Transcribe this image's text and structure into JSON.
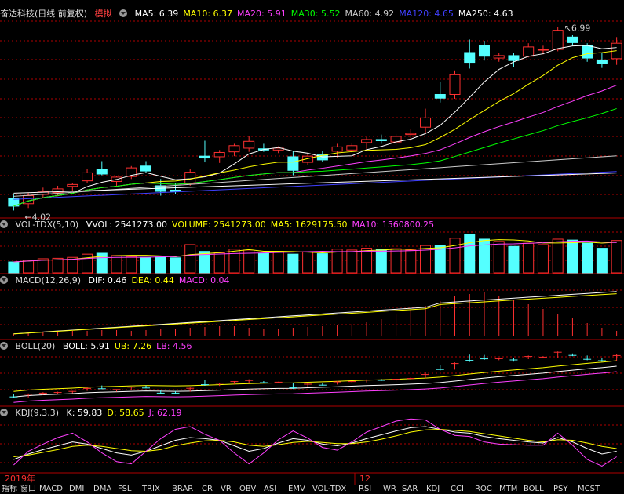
{
  "main_header": {
    "stock_name": "奋达科技(日线 前复权)",
    "mode": "模拟",
    "ma": [
      {
        "label": "MA5: 6.39",
        "color": "#ffffff"
      },
      {
        "label": "MA10: 6.37",
        "color": "#ffff00"
      },
      {
        "label": "MA20: 5.91",
        "color": "#ff40ff"
      },
      {
        "label": "MA30: 5.52",
        "color": "#00ff00"
      },
      {
        "label": "MA60: 4.92",
        "color": "#cccccc"
      },
      {
        "label": "MA120: 4.65",
        "color": "#4040ff"
      },
      {
        "label": "MA250: 4.63",
        "color": "#ffffff"
      }
    ]
  },
  "vol_header": {
    "name": "VOL-TDX(5,10)",
    "items": [
      {
        "label": "VVOL: 2541273.00",
        "color": "#ffffff"
      },
      {
        "label": "VOLUME: 2541273.00",
        "color": "#ffff00"
      },
      {
        "label": "MA5: 1629175.50",
        "color": "#ffff00"
      },
      {
        "label": "MA10: 1560800.25",
        "color": "#ff40ff"
      }
    ]
  },
  "macd_header": {
    "name": "MACD(12,26,9)",
    "items": [
      {
        "label": "DIF: 0.46",
        "color": "#ffffff"
      },
      {
        "label": "DEA: 0.44",
        "color": "#ffff00"
      },
      {
        "label": "MACD: 0.04",
        "color": "#ff40ff"
      }
    ]
  },
  "boll_header": {
    "name": "BOLL(20)",
    "items": [
      {
        "label": "BOLL: 5.91",
        "color": "#ffffff"
      },
      {
        "label": "UB: 7.26",
        "color": "#ffff00"
      },
      {
        "label": "LB: 4.56",
        "color": "#ff40ff"
      }
    ]
  },
  "kdj_header": {
    "name": "KDJ(9,3,3)",
    "items": [
      {
        "label": "K: 59.83",
        "color": "#ffffff"
      },
      {
        "label": "D: 58.65",
        "color": "#ffff00"
      },
      {
        "label": "J: 62.19",
        "color": "#ff40ff"
      }
    ]
  },
  "time_axis": {
    "labels": [
      "2019年",
      "12"
    ]
  },
  "indicator_tabs": [
    "指标",
    "窗口",
    "MACD",
    "DMI",
    "DMA",
    "FSL",
    "TRIX",
    "BRAR",
    "CR",
    "VR",
    "OBV",
    "ASI",
    "EMV",
    "VOL-TDX",
    "RSI",
    "WR",
    "SAR",
    "KDJ",
    "CCI",
    "ROC",
    "MTM",
    "BOLL",
    "PSY",
    "MCST"
  ],
  "colors": {
    "up": "#ff3030",
    "down": "#54ffff",
    "grid": "#b00000",
    "bg": "#000000"
  },
  "chart_data": {
    "type": "candlestick",
    "annotations": [
      {
        "label": "6.99",
        "type": "high"
      },
      {
        "label": "4.02",
        "type": "low"
      }
    ],
    "candles": [
      {
        "o": 4.22,
        "h": 4.28,
        "l": 4.02,
        "c": 4.09
      },
      {
        "o": 4.13,
        "h": 4.31,
        "l": 4.06,
        "c": 4.26
      },
      {
        "o": 4.28,
        "h": 4.39,
        "l": 4.22,
        "c": 4.33
      },
      {
        "o": 4.31,
        "h": 4.42,
        "l": 4.25,
        "c": 4.37
      },
      {
        "o": 4.41,
        "h": 4.47,
        "l": 4.33,
        "c": 4.44
      },
      {
        "o": 4.5,
        "h": 4.69,
        "l": 4.47,
        "c": 4.63
      },
      {
        "o": 4.69,
        "h": 4.82,
        "l": 4.59,
        "c": 4.61
      },
      {
        "o": 4.49,
        "h": 4.58,
        "l": 4.42,
        "c": 4.56
      },
      {
        "o": 4.57,
        "h": 4.74,
        "l": 4.53,
        "c": 4.71
      },
      {
        "o": 4.74,
        "h": 4.82,
        "l": 4.64,
        "c": 4.66
      },
      {
        "o": 4.42,
        "h": 4.53,
        "l": 4.26,
        "c": 4.33
      },
      {
        "o": 4.35,
        "h": 4.46,
        "l": 4.28,
        "c": 4.33
      },
      {
        "o": 4.45,
        "h": 4.69,
        "l": 4.42,
        "c": 4.64
      },
      {
        "o": 4.9,
        "h": 5.15,
        "l": 4.8,
        "c": 4.87
      },
      {
        "o": 4.89,
        "h": 5.0,
        "l": 4.79,
        "c": 4.96
      },
      {
        "o": 4.97,
        "h": 5.1,
        "l": 4.9,
        "c": 5.07
      },
      {
        "o": 5.03,
        "h": 5.22,
        "l": 4.97,
        "c": 5.14
      },
      {
        "o": 5.02,
        "h": 5.1,
        "l": 4.97,
        "c": 5.0
      },
      {
        "o": 5.0,
        "h": 5.06,
        "l": 4.95,
        "c": 5.03
      },
      {
        "o": 4.89,
        "h": 4.98,
        "l": 4.59,
        "c": 4.67
      },
      {
        "o": 4.8,
        "h": 4.95,
        "l": 4.75,
        "c": 4.9
      },
      {
        "o": 4.92,
        "h": 4.98,
        "l": 4.81,
        "c": 4.84
      },
      {
        "o": 4.98,
        "h": 5.1,
        "l": 4.88,
        "c": 5.05
      },
      {
        "o": 5.0,
        "h": 5.11,
        "l": 4.96,
        "c": 5.07
      },
      {
        "o": 5.12,
        "h": 5.21,
        "l": 5.02,
        "c": 5.17
      },
      {
        "o": 5.17,
        "h": 5.25,
        "l": 5.1,
        "c": 5.15
      },
      {
        "o": 5.13,
        "h": 5.26,
        "l": 5.08,
        "c": 5.22
      },
      {
        "o": 5.25,
        "h": 5.34,
        "l": 5.15,
        "c": 5.27
      },
      {
        "o": 5.37,
        "h": 5.67,
        "l": 5.28,
        "c": 5.52
      },
      {
        "o": 5.9,
        "h": 6.11,
        "l": 5.77,
        "c": 5.84
      },
      {
        "o": 5.9,
        "h": 6.29,
        "l": 5.83,
        "c": 6.22
      },
      {
        "o": 6.58,
        "h": 6.79,
        "l": 6.32,
        "c": 6.42
      },
      {
        "o": 6.69,
        "h": 6.77,
        "l": 6.45,
        "c": 6.52
      },
      {
        "o": 6.49,
        "h": 6.58,
        "l": 6.43,
        "c": 6.53
      },
      {
        "o": 6.53,
        "h": 6.57,
        "l": 6.34,
        "c": 6.45
      },
      {
        "o": 6.52,
        "h": 6.73,
        "l": 6.5,
        "c": 6.67
      },
      {
        "o": 6.63,
        "h": 6.69,
        "l": 6.55,
        "c": 6.63
      },
      {
        "o": 6.63,
        "h": 6.99,
        "l": 6.6,
        "c": 6.94
      },
      {
        "o": 6.83,
        "h": 6.86,
        "l": 6.69,
        "c": 6.74
      },
      {
        "o": 6.69,
        "h": 6.73,
        "l": 6.43,
        "c": 6.49
      },
      {
        "o": 6.46,
        "h": 6.57,
        "l": 6.33,
        "c": 6.4
      },
      {
        "o": 6.48,
        "h": 6.83,
        "l": 6.38,
        "c": 6.73
      }
    ],
    "volume": [
      120,
      140,
      155,
      160,
      170,
      205,
      215,
      190,
      180,
      170,
      175,
      165,
      310,
      235,
      220,
      260,
      250,
      215,
      235,
      205,
      230,
      210,
      260,
      250,
      270,
      255,
      265,
      250,
      300,
      305,
      380,
      420,
      370,
      345,
      290,
      325,
      310,
      370,
      360,
      325,
      270,
      355
    ],
    "macd": [
      0.02,
      0.03,
      0.04,
      0.05,
      0.06,
      0.06,
      0.07,
      0.07,
      0.06,
      0.07,
      0.08,
      0.08,
      0.1,
      0.11,
      0.12,
      0.12,
      0.1,
      0.09,
      0.09,
      0.1,
      0.11,
      0.12,
      0.13,
      0.15,
      0.17,
      0.21,
      0.27,
      0.33,
      0.38,
      0.44,
      0.5,
      0.53,
      0.55,
      0.5,
      0.45,
      0.4,
      0.34,
      0.28,
      0.22,
      0.16,
      0.1,
      0.06
    ],
    "kdj": {
      "k": [
        20,
        30,
        38,
        45,
        52,
        48,
        40,
        32,
        28,
        35,
        45,
        55,
        60,
        58,
        55,
        45,
        35,
        40,
        50,
        58,
        55,
        48,
        45,
        50,
        58,
        65,
        72,
        78,
        80,
        75,
        70,
        68,
        62,
        58,
        55,
        52,
        50,
        60,
        52,
        40,
        30,
        35
      ],
      "d": [
        25,
        28,
        33,
        38,
        44,
        46,
        44,
        40,
        36,
        35,
        38,
        45,
        50,
        54,
        55,
        52,
        46,
        44,
        47,
        51,
        53,
        51,
        49,
        49,
        52,
        57,
        63,
        70,
        74,
        75,
        73,
        71,
        67,
        63,
        59,
        55,
        52,
        56,
        55,
        50,
        44,
        40
      ],
      "j": [
        10,
        35,
        48,
        60,
        68,
        52,
        32,
        16,
        12,
        35,
        58,
        75,
        80,
        66,
        55,
        32,
        12,
        32,
        56,
        72,
        59,
        42,
        37,
        52,
        70,
        80,
        90,
        94,
        92,
        75,
        64,
        62,
        52,
        48,
        47,
        46,
        46,
        68,
        46,
        20,
        8,
        25
      ]
    }
  }
}
